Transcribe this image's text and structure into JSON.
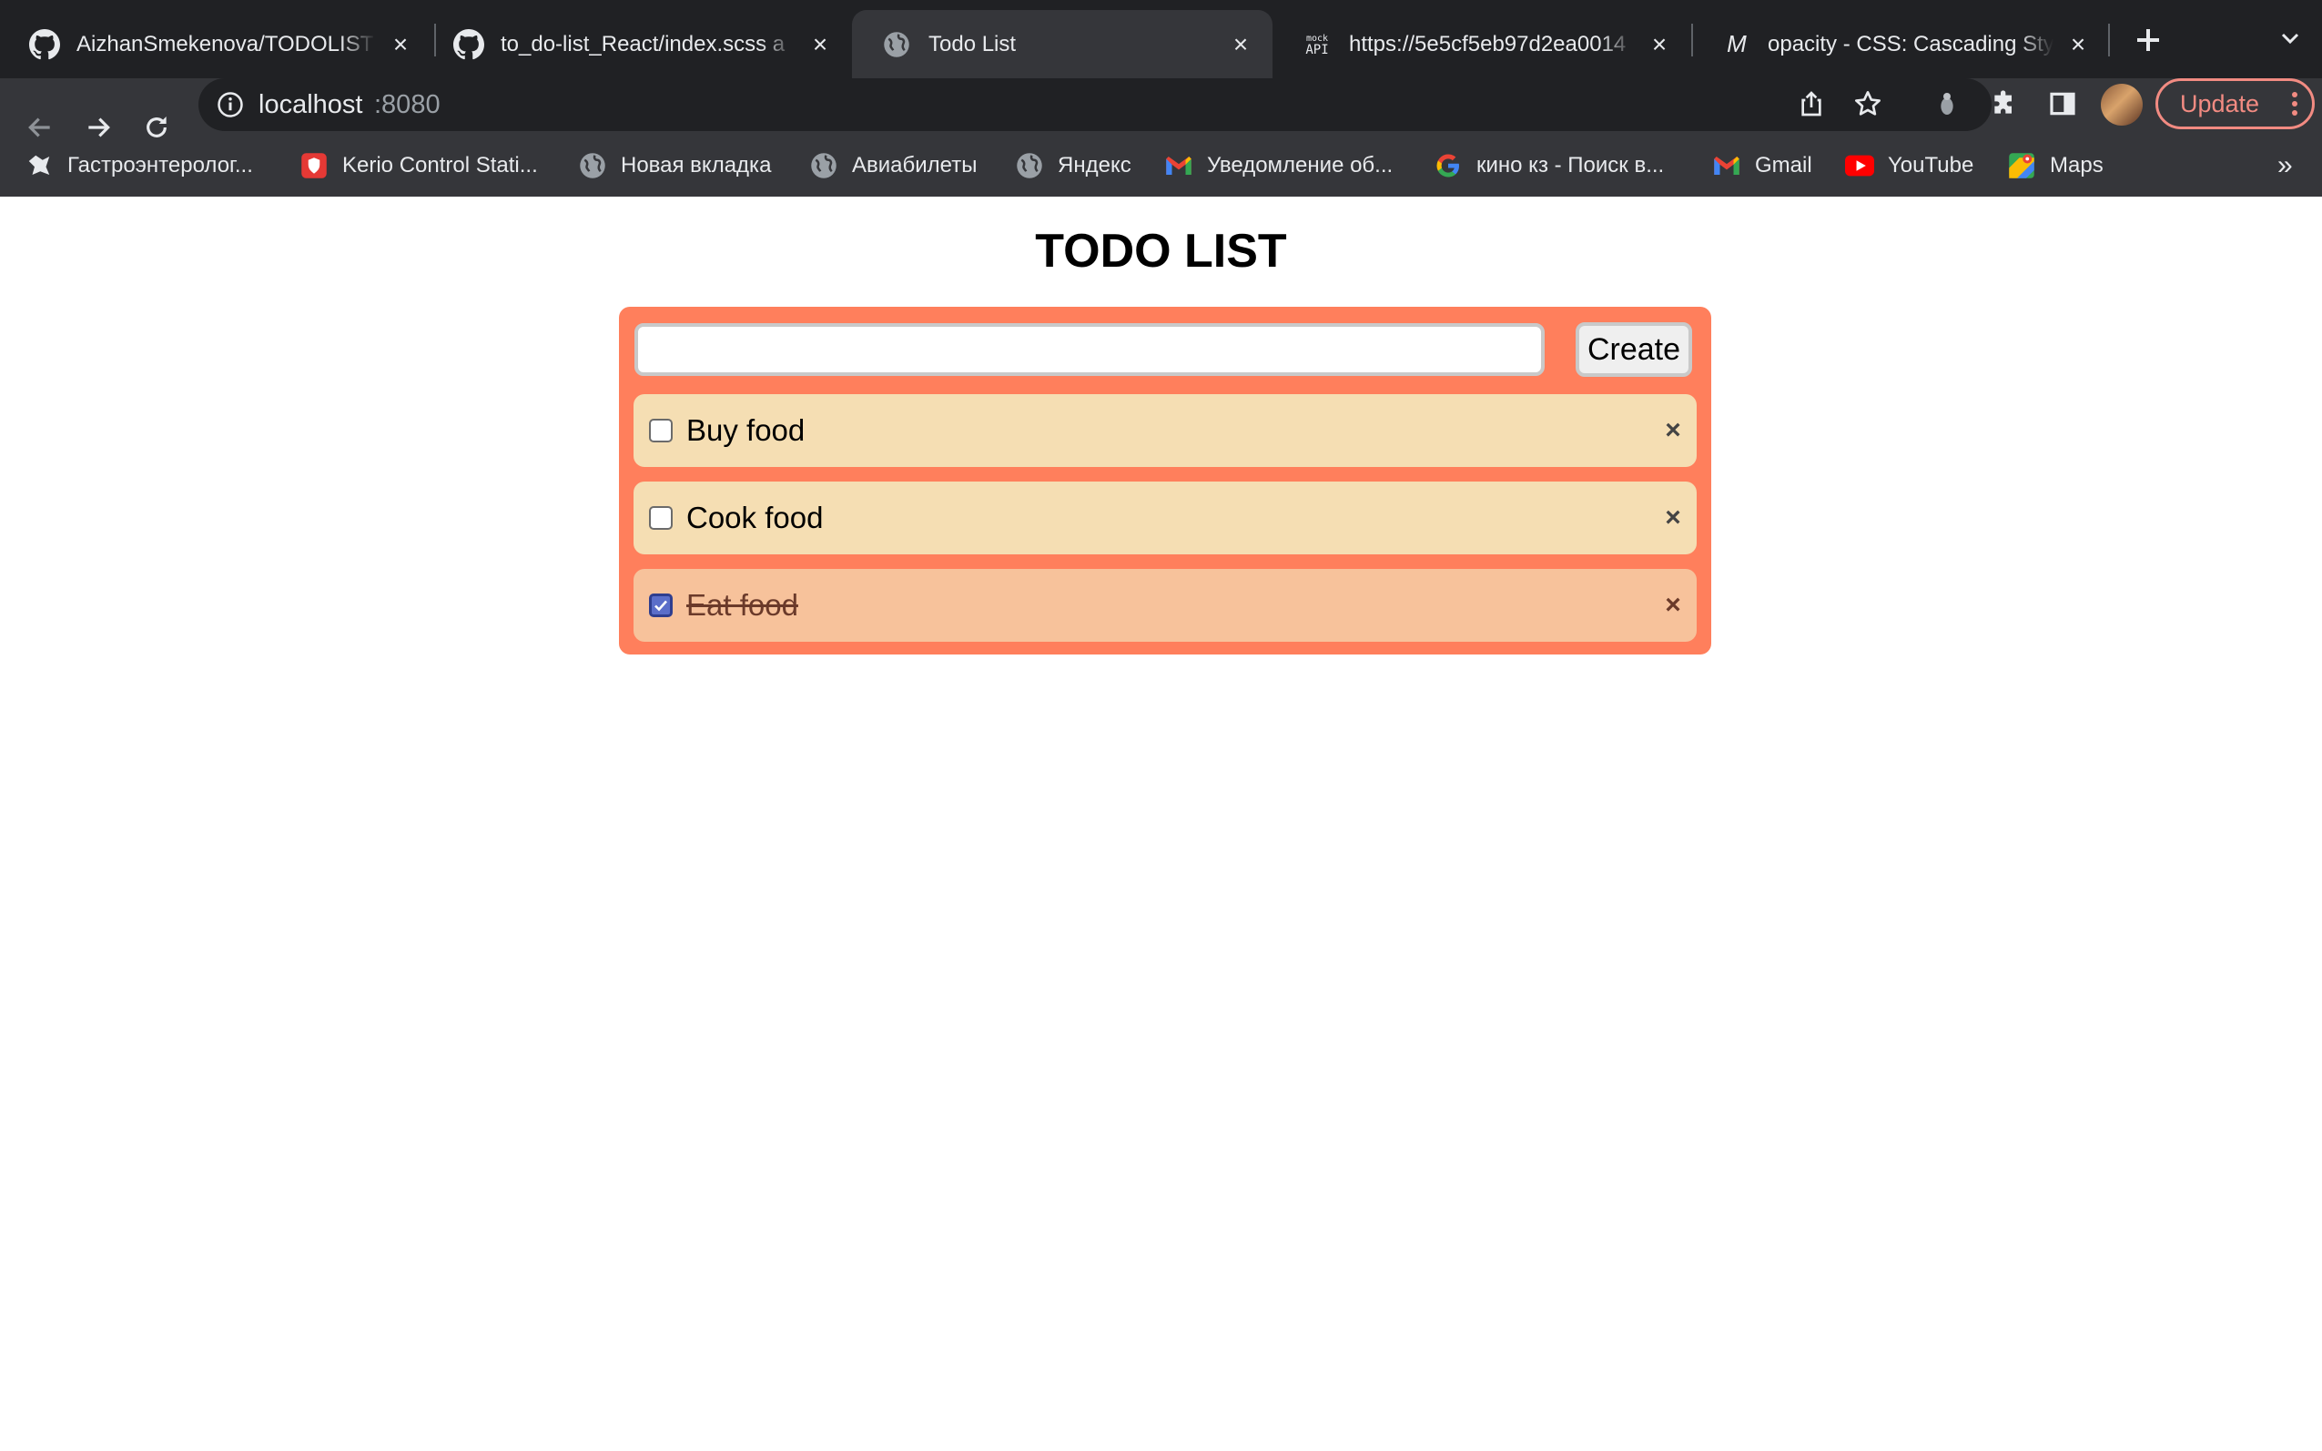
{
  "browser": {
    "tabs": [
      {
        "title": "AizhanSmekenova/TODOLIST",
        "icon": "github-icon"
      },
      {
        "title": "to_do-list_React/index.scss a",
        "icon": "github-icon"
      },
      {
        "title": "Todo List",
        "icon": "globe-icon"
      },
      {
        "title": "https://5e5cf5eb97d2ea0014",
        "icon": "mockapi-icon"
      },
      {
        "title": "opacity - CSS: Cascading Sty",
        "icon": "mdn-icon"
      }
    ],
    "mockapi_icon_text_top": "mock",
    "mockapi_icon_text_bottom": "API",
    "mdn_icon_text": "M",
    "address": {
      "host": "localhost",
      "port": ":8080"
    },
    "update_label": "Update",
    "bookmarks": [
      {
        "label": "Гастроэнтеролог...",
        "icon": "clinic-icon"
      },
      {
        "label": "Kerio Control Stati...",
        "icon": "shield-icon"
      },
      {
        "label": "Новая вкладка",
        "icon": "globe-icon"
      },
      {
        "label": "Авиабилеты",
        "icon": "globe-icon"
      },
      {
        "label": "Яндекс",
        "icon": "globe-icon"
      },
      {
        "label": "Уведомление об...",
        "icon": "gmail-icon"
      },
      {
        "label": "кино кз - Поиск в...",
        "icon": "google-icon"
      },
      {
        "label": "Gmail",
        "icon": "gmail-icon"
      },
      {
        "label": "YouTube",
        "icon": "youtube-icon"
      },
      {
        "label": "Maps",
        "icon": "maps-icon"
      }
    ],
    "overflow_label": "»"
  },
  "app": {
    "title": "TODO LIST",
    "input_value": "",
    "create_label": "Create",
    "delete_glyph": "×",
    "todos": [
      {
        "label": "Buy food",
        "done": false
      },
      {
        "label": "Cook food",
        "done": false
      },
      {
        "label": "Eat food",
        "done": true
      }
    ]
  },
  "colors": {
    "panel": "#ff7f5c",
    "todo": "#f5deb3",
    "todo_done": "#f7c29b",
    "chrome_dark": "#202124",
    "chrome_toolbar": "#35363a",
    "update_accent": "#f28b82"
  }
}
